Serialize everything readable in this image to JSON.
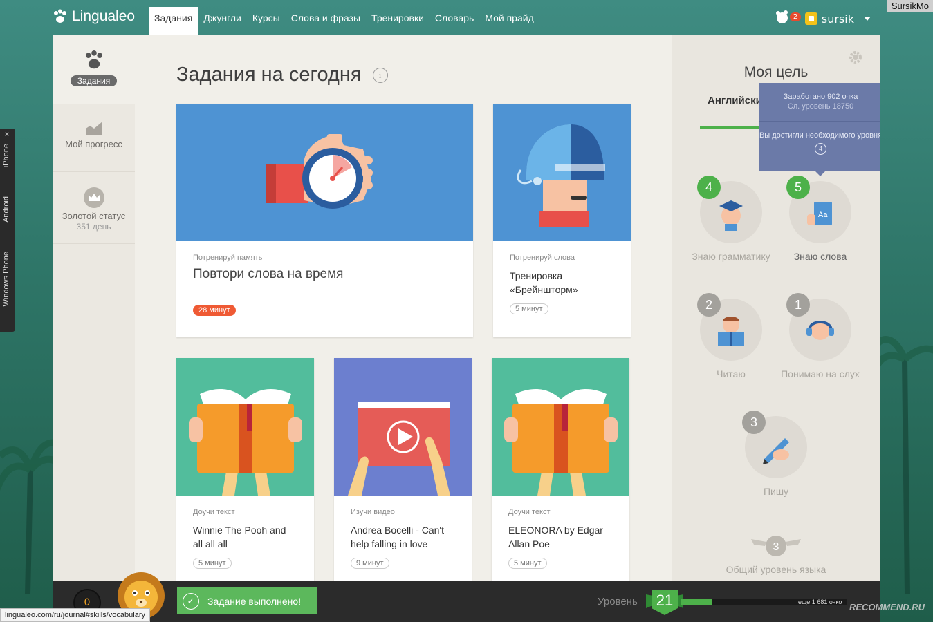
{
  "corner_user": "SursikMo",
  "brand": {
    "name": "Lingualeo"
  },
  "nav": {
    "items": [
      {
        "label": "Задания",
        "active": true
      },
      {
        "label": "Джунгли"
      },
      {
        "label": "Курсы"
      },
      {
        "label": "Слова и фразы"
      },
      {
        "label": "Тренировки"
      },
      {
        "label": "Словарь"
      },
      {
        "label": "Мой прайд"
      }
    ],
    "notifications": "2",
    "username": "sursik"
  },
  "sidebar": {
    "tasks": "Задания",
    "progress": "Мой прогресс",
    "gold_status": "Золотой статус",
    "gold_days": "351 день"
  },
  "main": {
    "title": "Задания на сегодня",
    "info_glyph": "i",
    "cards": [
      {
        "kicker": "Потренируй память",
        "title": "Повтори слова на время",
        "duration": "28 минут",
        "color": "#4e93d3"
      },
      {
        "kicker": "Потренируй слова",
        "title": "Тренировка «Брейншторм»",
        "duration": "5 минут",
        "color": "#4e93d3"
      },
      {
        "kicker": "Доучи текст",
        "title": "Winnie The Pooh and all all all",
        "duration": "5 минут",
        "color": "#52bd9c"
      },
      {
        "kicker": "Изучи видео",
        "title": "Andrea Bocelli - Can't help falling in love",
        "duration": "9 минут",
        "color": "#6c7fcf"
      },
      {
        "kicker": "Доучи текст",
        "title": "ELEONORA by Edgar Allan Poe",
        "duration": "5 минут",
        "color": "#52bd9c"
      }
    ]
  },
  "goal": {
    "title": "Моя цель",
    "language_tab": "Английский",
    "tooltip": {
      "earned": "Заработано 902 очка",
      "next": "Сл. уровень 18750",
      "reached": "Вы достигли необходимого уровня",
      "level": "4"
    },
    "skills": [
      {
        "level": "4",
        "label": "Знаю грамматику",
        "state": "green"
      },
      {
        "level": "5",
        "label": "Знаю слова",
        "state": "green"
      },
      {
        "level": "2",
        "label": "Читаю",
        "state": "grey"
      },
      {
        "level": "1",
        "label": "Понимаю на слух",
        "state": "grey"
      },
      {
        "level": "3",
        "label": "Пишу",
        "state": "grey"
      }
    ],
    "overall_level": "3",
    "overall_label": "Общий уровень языка"
  },
  "bottom": {
    "coins": "0",
    "toast": "Задание выполнено!",
    "check_glyph": "✓",
    "level_label": "Уровень",
    "level": "21",
    "xp_progress": 0.19,
    "xp_remaining": "еще 1 681 очко"
  },
  "status_url": "lingualeo.com/ru/journal#skills/vocabulary",
  "devices": [
    "iPhone",
    "Android",
    "Windows Phone"
  ],
  "close_glyph": "x",
  "watermark": "RECOMMEND.RU",
  "colors": {
    "accent_green": "#4db14a",
    "hot": "#ef5a34",
    "card_blue": "#4e93d3",
    "card_teal": "#52bd9c",
    "card_purple": "#6c7fcf"
  }
}
